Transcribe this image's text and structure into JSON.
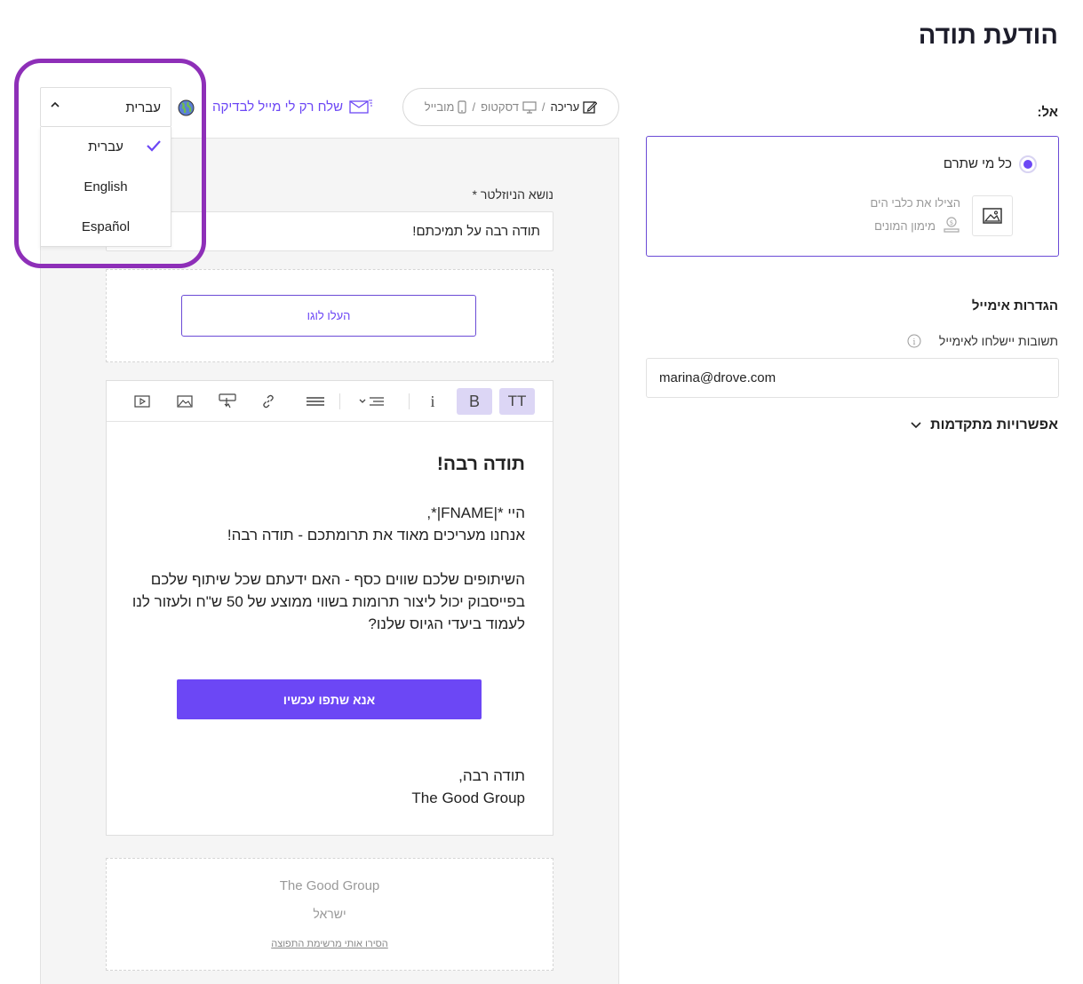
{
  "page": {
    "title": "הודעת תודה"
  },
  "recipients": {
    "label": "אל:",
    "option_label": "כל מי שתרם",
    "campaign_name": "הצילו את כלבי הים",
    "fund_label": "מימון המונים"
  },
  "email_settings": {
    "title": "הגדרות אימייל",
    "reply_label": "תשובות יישלחו לאימייל",
    "reply_value": "marina@drove.com",
    "advanced_label": "אפשרויות מתקדמות"
  },
  "view_toggle": {
    "edit": "עריכה",
    "desktop": "דסקטופ",
    "mobile": "מובייל",
    "separator": "/"
  },
  "test_mail": {
    "label": "שלח רק לי מייל לבדיקה"
  },
  "language": {
    "selected": "עברית",
    "options": [
      "עברית",
      "English",
      "Español"
    ]
  },
  "editor": {
    "subject_label": "נושא הניוזלטר *",
    "subject_value": "תודה רבה על תמיכתם!",
    "upload_logo": "העלו לוגו",
    "heading": "תודה רבה!",
    "line1": "היי *|FNAME|*,",
    "line2": "אנחנו מעריכים מאוד את תרומתכם - תודה רבה!",
    "line3": "השיתופים שלכם שווים כסף - האם ידעתם שכל שיתוף שלכם",
    "line4": "בפייסבוק יכול ליצור תרומות בשווי ממוצע של 50 ש\"ח ולעזור לנו",
    "line5": "לעמוד ביעדי הגיוס שלנו?",
    "cta": "אנא שתפו עכשיו",
    "signoff1": "תודה רבה,",
    "signoff2": "The Good Group",
    "toolbar": {
      "italic": "i",
      "bold": "B",
      "text_size": "TT"
    }
  },
  "footer": {
    "org": "The Good Group",
    "country": "ישראל",
    "unsubscribe": "הסירו אותי מרשימת התפוצה"
  },
  "colors": {
    "accent": "#6c47f5",
    "highlight": "#8e2fb8"
  }
}
